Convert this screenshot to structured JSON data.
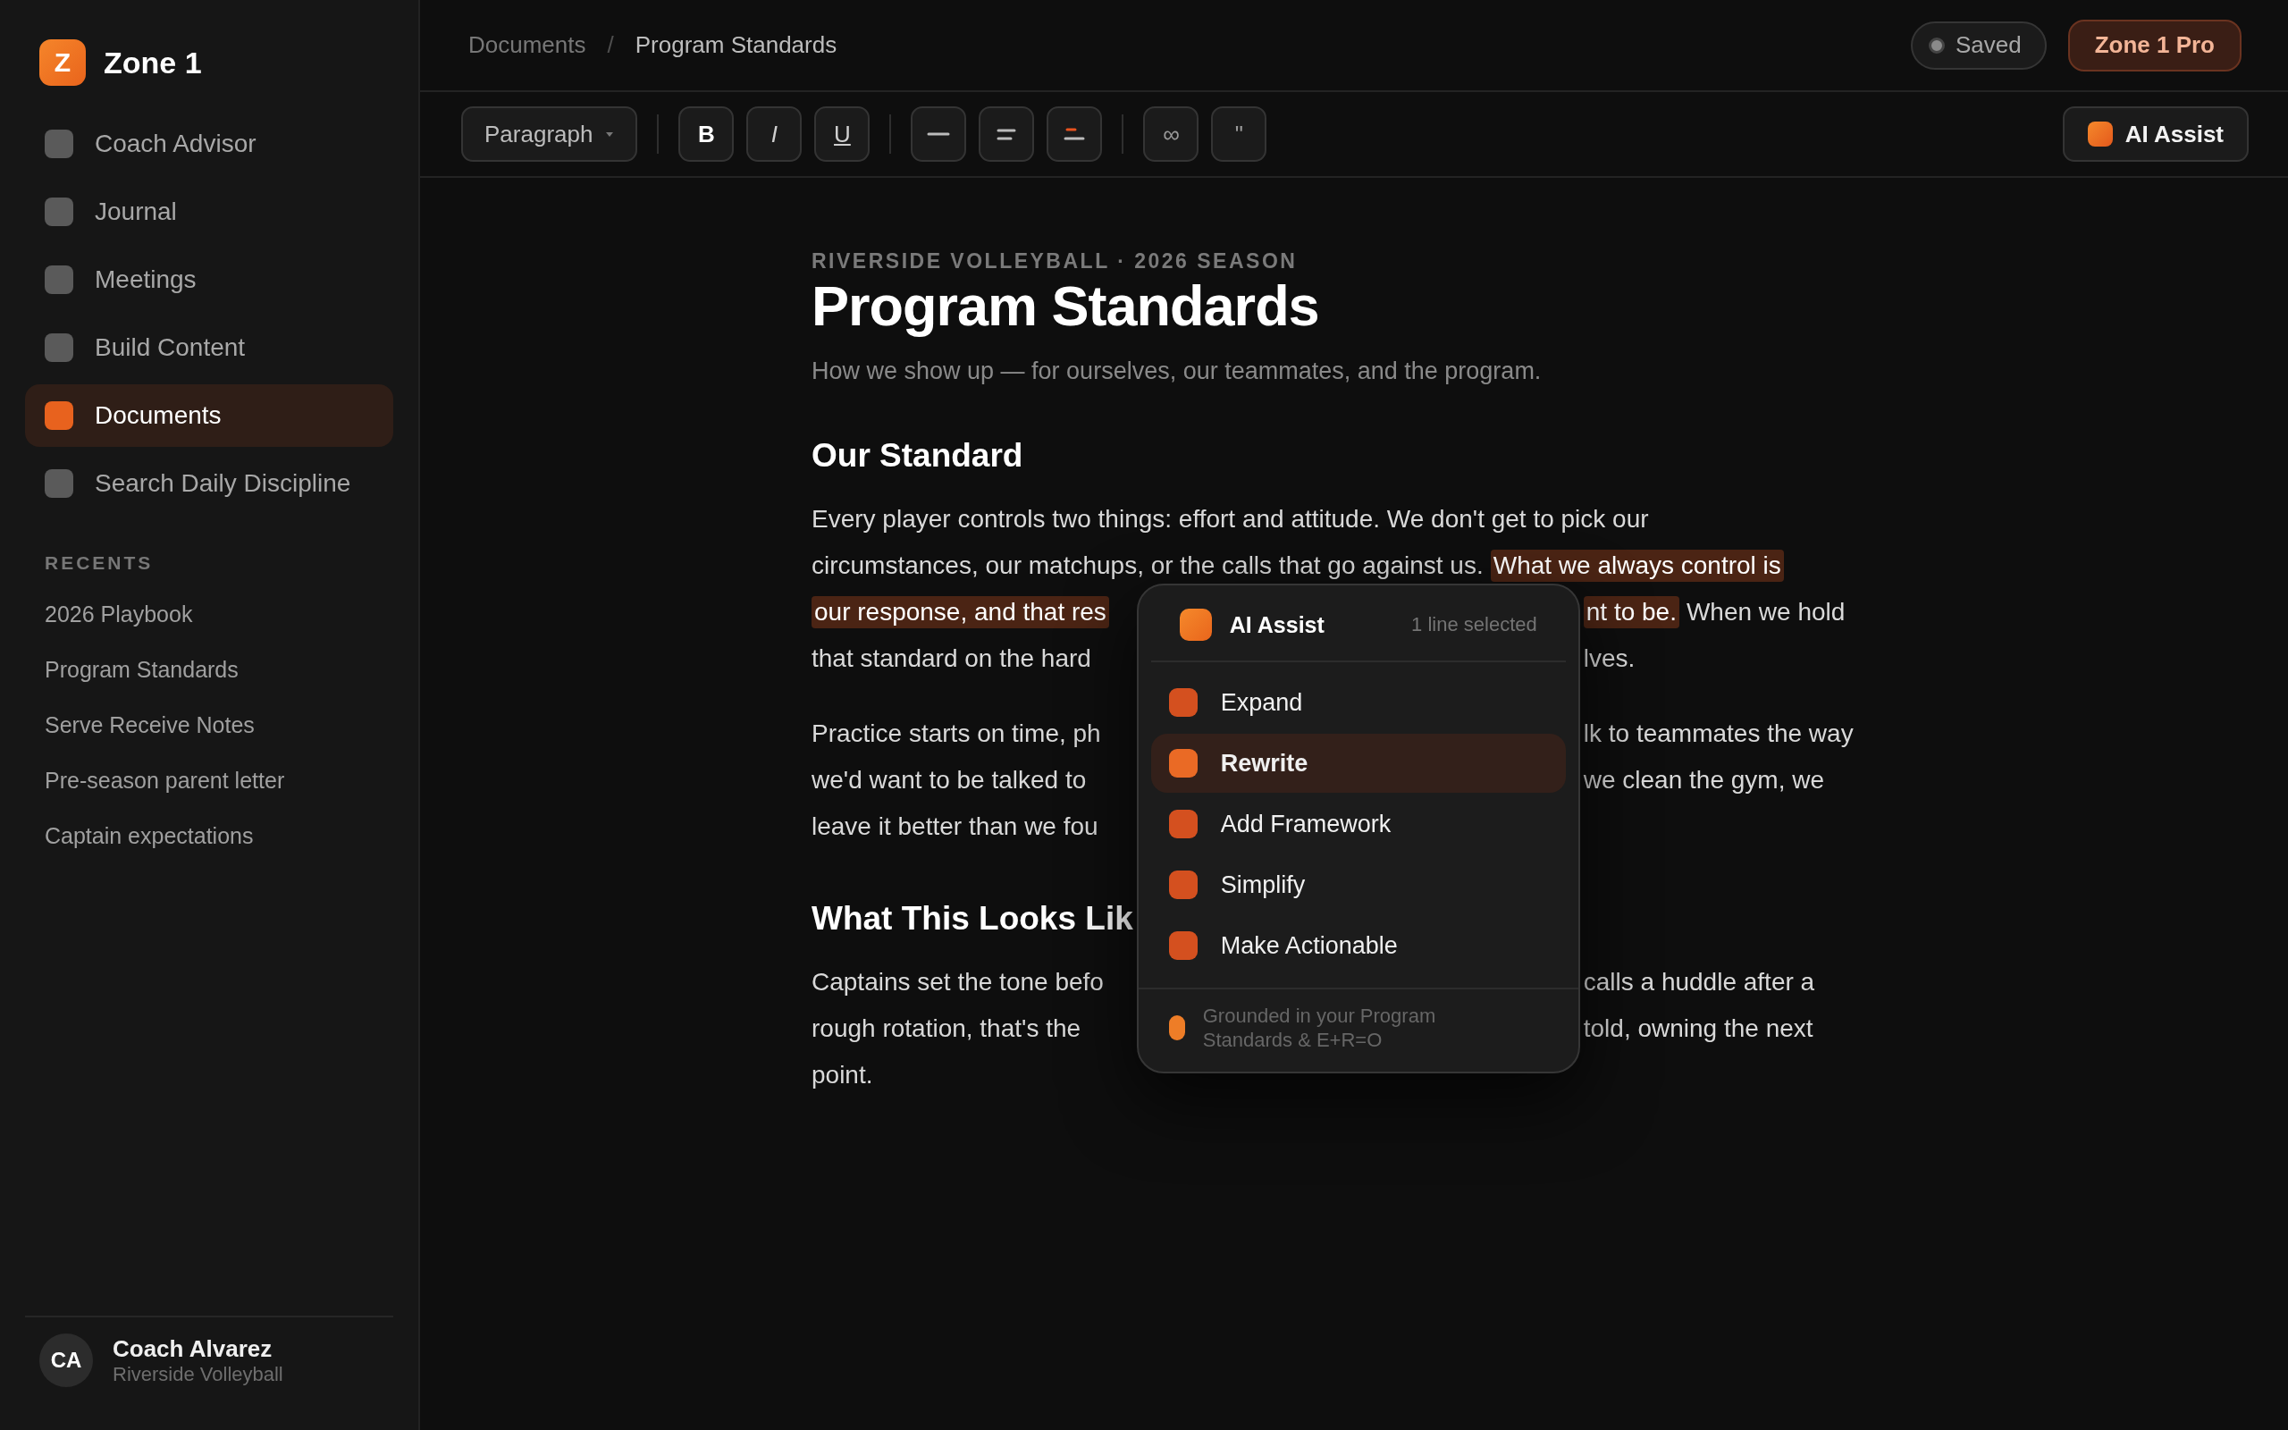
{
  "sidebar": {
    "brand": {
      "initial": "Z",
      "name": "Zone 1"
    },
    "nav": [
      {
        "label": "Coach Advisor",
        "selected": false
      },
      {
        "label": "Journal",
        "selected": false
      },
      {
        "label": "Meetings",
        "selected": false
      },
      {
        "label": "Build Content",
        "selected": false
      },
      {
        "label": "Documents",
        "selected": true
      },
      {
        "label": "Search Daily Discipline",
        "selected": false
      }
    ],
    "recents_heading": "RECENTS",
    "recents": [
      "2026 Playbook",
      "Program Standards",
      "Serve Receive Notes",
      "Pre-season parent letter",
      "Captain expectations"
    ],
    "user": {
      "initials": "CA",
      "name": "Coach Alvarez",
      "team": "Riverside Volleyball"
    }
  },
  "topbar": {
    "breadcrumb": [
      "Documents",
      "Program Standards"
    ],
    "separator": "/",
    "status": "Saved",
    "upgrade": "Zone 1 Pro"
  },
  "toolbar": {
    "format": "Paragraph",
    "groups": [
      [
        {
          "kind": "bold",
          "label": "B"
        },
        {
          "kind": "italic",
          "label": "I"
        },
        {
          "kind": "underline",
          "label": "U"
        }
      ],
      [
        {
          "kind": "rule"
        },
        {
          "kind": "lines"
        },
        {
          "kind": "accent-lines"
        }
      ],
      [
        {
          "kind": "plain",
          "label": "∞"
        },
        {
          "kind": "plain",
          "label": "\""
        }
      ]
    ],
    "assist": "AI Assist"
  },
  "document": {
    "eyebrow": "RIVERSIDE VOLLEYBALL · 2026 SEASON",
    "title": "Program Standards",
    "subtitle": "How we show up — for ourselves, our teammates, and the program.",
    "sections": [
      {
        "heading": "Our Standard",
        "paragraphs": [
          [
            {
              "left": [
                {
                  "text": "Every player controls two things: effort and attitude. We don't get to pick our",
                  "highlighted": false
                }
              ]
            },
            {
              "left": [
                {
                  "text": "circumstances, our matchups, or the calls that go against us.",
                  "highlighted": false
                },
                {
                  "text": "What we always control is",
                  "highlighted": true
                }
              ]
            },
            {
              "left": [
                {
                  "text": "our response, and that res",
                  "highlighted": true
                }
              ],
              "right": [
                {
                  "text": "nt to be.",
                  "highlighted": true
                },
                {
                  "text": "When we hold",
                  "highlighted": false
                }
              ]
            },
            {
              "left": [
                {
                  "text": "that standard on the hard",
                  "highlighted": false
                }
              ],
              "right": [
                {
                  "text": "lves.",
                  "highlighted": false
                }
              ]
            }
          ],
          [
            {
              "left": [
                {
                  "text": "Practice starts on time, ph",
                  "highlighted": false
                }
              ],
              "right": [
                {
                  "text": "lk to teammates the way",
                  "highlighted": false
                }
              ]
            },
            {
              "left": [
                {
                  "text": "we'd want to be talked to",
                  "highlighted": false
                }
              ],
              "right": [
                {
                  "text": "we clean the gym, we",
                  "highlighted": false
                }
              ]
            },
            {
              "left": [
                {
                  "text": "leave it better than we fou",
                  "highlighted": false
                }
              ]
            }
          ]
        ]
      },
      {
        "heading": "What This Looks Lik",
        "paragraphs": [
          [
            {
              "left": [
                {
                  "text": "Captains set the tone befo",
                  "highlighted": false
                }
              ],
              "right": [
                {
                  "text": "calls a huddle after a",
                  "highlighted": false
                }
              ]
            },
            {
              "left": [
                {
                  "text": "rough rotation, that's the",
                  "highlighted": false
                }
              ],
              "right": [
                {
                  "text": "told, owning the next",
                  "highlighted": false
                }
              ]
            },
            {
              "left": [
                {
                  "text": "point.",
                  "highlighted": false
                }
              ]
            }
          ]
        ]
      }
    ]
  },
  "assist_menu": {
    "title": "AI Assist",
    "selection": "1 line selected",
    "items": [
      {
        "label": "Expand",
        "selected": false
      },
      {
        "label": "Rewrite",
        "selected": true
      },
      {
        "label": "Add Framework",
        "selected": false
      },
      {
        "label": "Simplify",
        "selected": false
      },
      {
        "label": "Make Actionable",
        "selected": false
      }
    ],
    "note": "Grounded in your Program Standards & E+R=O"
  }
}
